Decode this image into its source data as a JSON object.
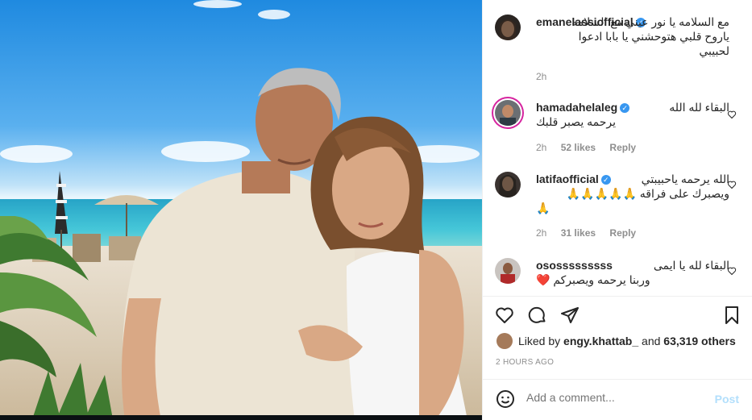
{
  "post": {
    "author": "emanelassiofficial",
    "caption": "مع السلامه يا نور عيني مع السلامه ياروح قلبي هتوحشني يا بابا ادعوا لحبيبي",
    "time": "2h"
  },
  "comments": [
    {
      "username": "hamadahelaleg",
      "line1": "البقاء لله الله",
      "line2": "يرحمه يصبر قلبك",
      "time": "2h",
      "likes": "52 likes",
      "reply": "Reply"
    },
    {
      "username": "latifaofficial",
      "line1": "الله يرحمه ياحبيبتي",
      "line2": "ويصبرك على فراقه 🙏🙏🙏🙏🙏",
      "line3": "🙏",
      "time": "2h",
      "likes": "31 likes",
      "reply": "Reply"
    },
    {
      "username": "ososssssssss",
      "line1": "البقاء لله يا ايمى",
      "line2": "وربنا يرحمه ويصبركم ❤️",
      "time": "",
      "likes": "",
      "reply": ""
    }
  ],
  "likes": {
    "prefix": "Liked by",
    "user": "engy.khattab_",
    "mid": "and",
    "count": "63,319 others"
  },
  "posted_ago": "2 HOURS AGO",
  "add_comment": {
    "placeholder": "Add a comment...",
    "post_label": "Post"
  },
  "icons": {
    "verified": "verified-badge-icon",
    "like": "heart-icon",
    "comment": "comment-bubble-icon",
    "share": "paper-plane-icon",
    "save": "bookmark-icon",
    "emoji": "smiley-icon"
  },
  "colors": {
    "verified": "#3897f0",
    "post_button": "#b2dffc",
    "muted": "#8e8e8e"
  }
}
